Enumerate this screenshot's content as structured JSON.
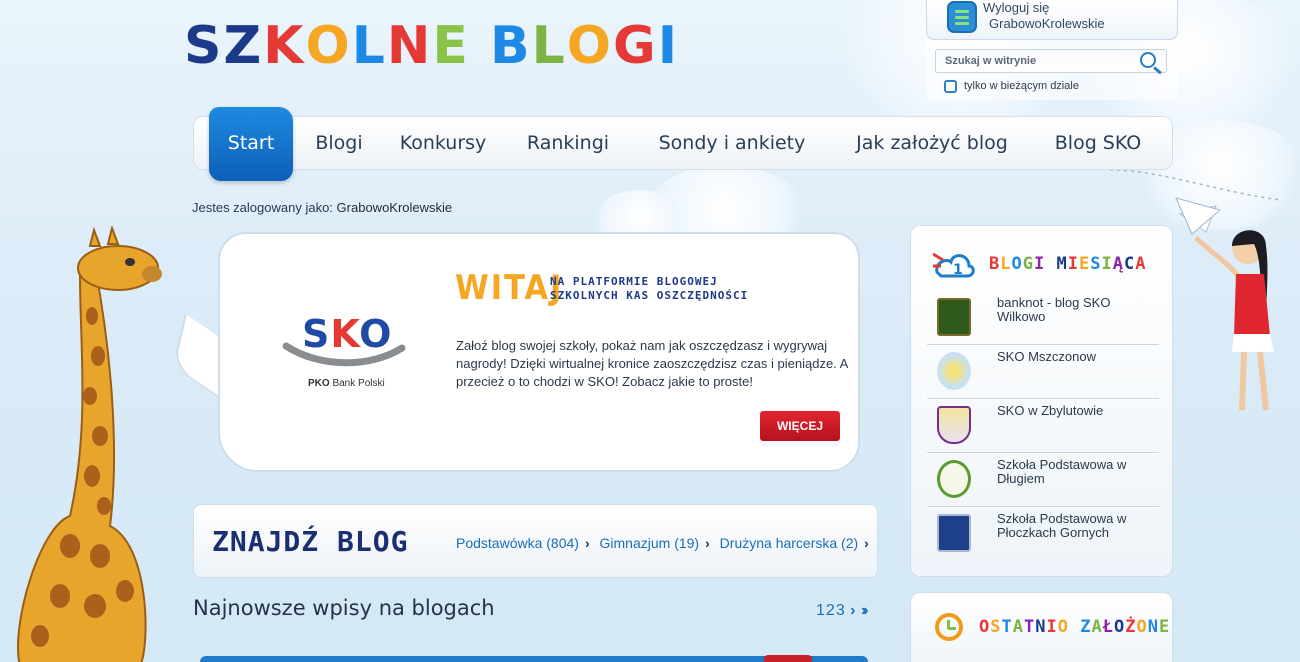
{
  "logo": {
    "letters": [
      "S",
      "Z",
      "K",
      "O",
      "L",
      "N",
      "E",
      " ",
      "B",
      "L",
      "O",
      "G",
      "I"
    ],
    "colors": [
      "#1b3a8a",
      "#1b3a8a",
      "#e53935",
      "#f5a623",
      "#1e88e5",
      "#e53935",
      "#8bc34a",
      "",
      "#1e88e5",
      "#7cb342",
      "#f5a623",
      "#e53935",
      "#1e88e5"
    ]
  },
  "account": {
    "logout_label": "Wyloguj się",
    "username": "GrabowoKrolewskie"
  },
  "search": {
    "placeholder": "Szukaj w witrynie",
    "checkbox_label": "tylko w bieżącym dziale",
    "checked": false
  },
  "nav": {
    "items": [
      {
        "label": "Start",
        "active": true
      },
      {
        "label": "Blogi",
        "active": false
      },
      {
        "label": "Konkursy",
        "active": false
      },
      {
        "label": "Rankingi",
        "active": false
      },
      {
        "label": "Sondy i ankiety",
        "active": false
      },
      {
        "label": "Jak założyć blog",
        "active": false
      },
      {
        "label": "Blog SKO",
        "active": false
      }
    ]
  },
  "logged_in": {
    "prefix": "Jestes zalogowany jako:",
    "user": "GrabowoKrolewskie"
  },
  "welcome": {
    "sko_logo_text": "SKO",
    "bank_bold": "PKO",
    "bank_rest": "Bank Polski",
    "title": "WITAJ",
    "subtitle_line1": "NA PLATFORMIE BLOGOWEJ",
    "subtitle_line2": "SZKOLNYCH KAS OSZCZĘDNOŚCI",
    "body": "Załoź blog swojej szkoły, pokaż nam jak oszczędzasz i wygrywaj nagrody! Dzięki wirtualnej kronice zaoszczędzisz czas i pieniądze. A przecież o to chodzi w SKO! Zobacz jakie to proste!",
    "more_button": "WIĘCEJ"
  },
  "find_blog": {
    "title": "ZNAJDŹ BLOG",
    "links": [
      "Podstawówka (804)",
      "Gimnazjum (19)",
      "Drużyna harcerska (2)"
    ]
  },
  "latest": {
    "title": "Najnowsze wpisy na blogach",
    "pages": [
      "1",
      "2",
      "3"
    ]
  },
  "blogs_of_month": {
    "title": "BLOGI MIESIĄCA",
    "items": [
      {
        "name": "banknot - blog SKO Wilkowo",
        "thumb_color": "#2f5a1c"
      },
      {
        "name": "SKO Mszczonow",
        "thumb_color": "#c7e0f2"
      },
      {
        "name": "SKO w Zbylutowie",
        "thumb_color": "#e9e2f0"
      },
      {
        "name": "Szkoła Podstawowa w Długiem",
        "thumb_color": "#f4f7ea"
      },
      {
        "name": "Szkoła Podstawowa w Płoczkach Gornych",
        "thumb_color": "#1e3f8a"
      }
    ]
  },
  "recent": {
    "title": "OSTATNIO ZAŁOŻONE"
  }
}
